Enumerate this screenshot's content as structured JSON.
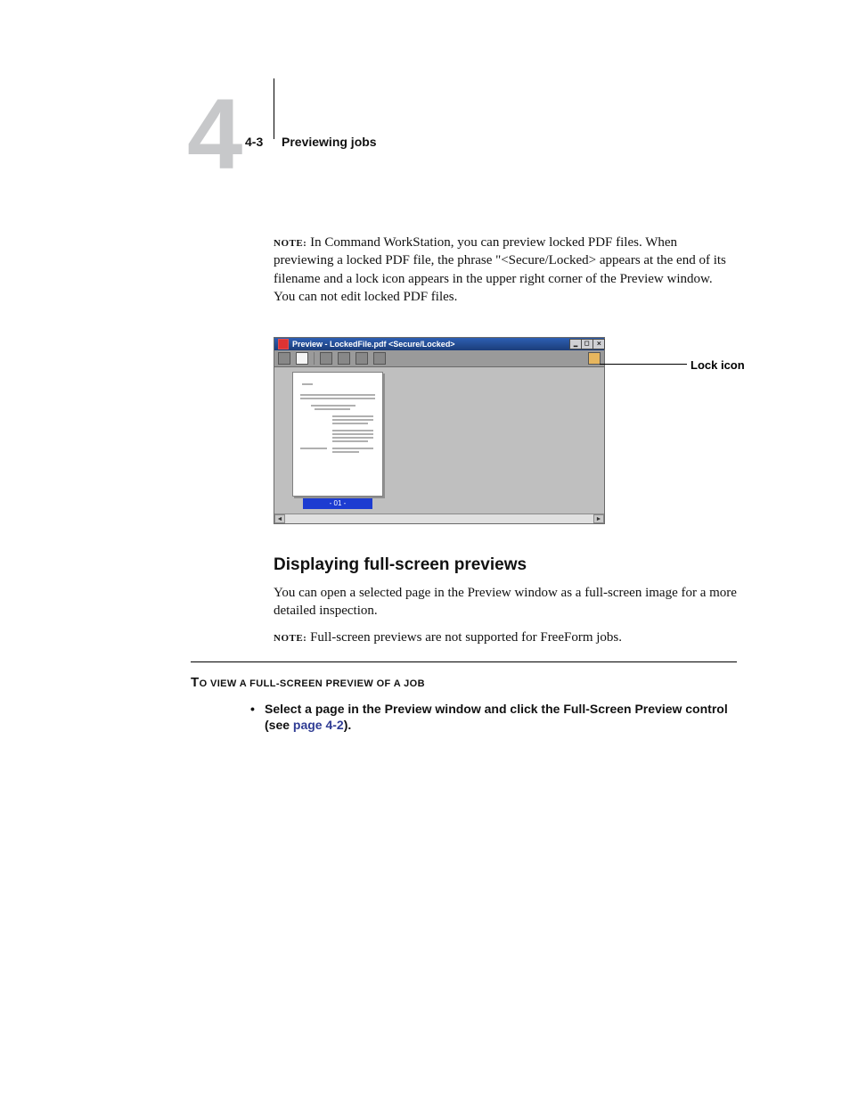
{
  "header": {
    "chapter_number": "4",
    "page_number": "4-3",
    "running_head": "Previewing jobs"
  },
  "note1": {
    "label": "NOTE:",
    "text": " In Command WorkStation, you can preview locked PDF files. When previewing a locked PDF file, the phrase \"<Secure/Locked> appears at the end of its filename and a lock icon appears in the upper right corner of the Preview window. You can not edit locked PDF files."
  },
  "figure": {
    "window_title": "Preview - LockedFile.pdf <Secure/Locked>",
    "thumb_label": "- 01 -",
    "callout": "Lock icon"
  },
  "section": {
    "heading": "Displaying full-screen previews",
    "para": "You can open a selected page in the Preview window as a full-screen image for a more detailed inspection."
  },
  "note2": {
    "label": "NOTE:",
    "text": " Full-screen previews are not supported for FreeForm jobs."
  },
  "procedure": {
    "first_cap": "T",
    "head_rest": "O VIEW A FULL-SCREEN PREVIEW OF A JOB",
    "step_pre": "Select a page in the Preview window and click the Full-Screen Preview control (see ",
    "xref": "page 4-2",
    "step_post": ")."
  }
}
